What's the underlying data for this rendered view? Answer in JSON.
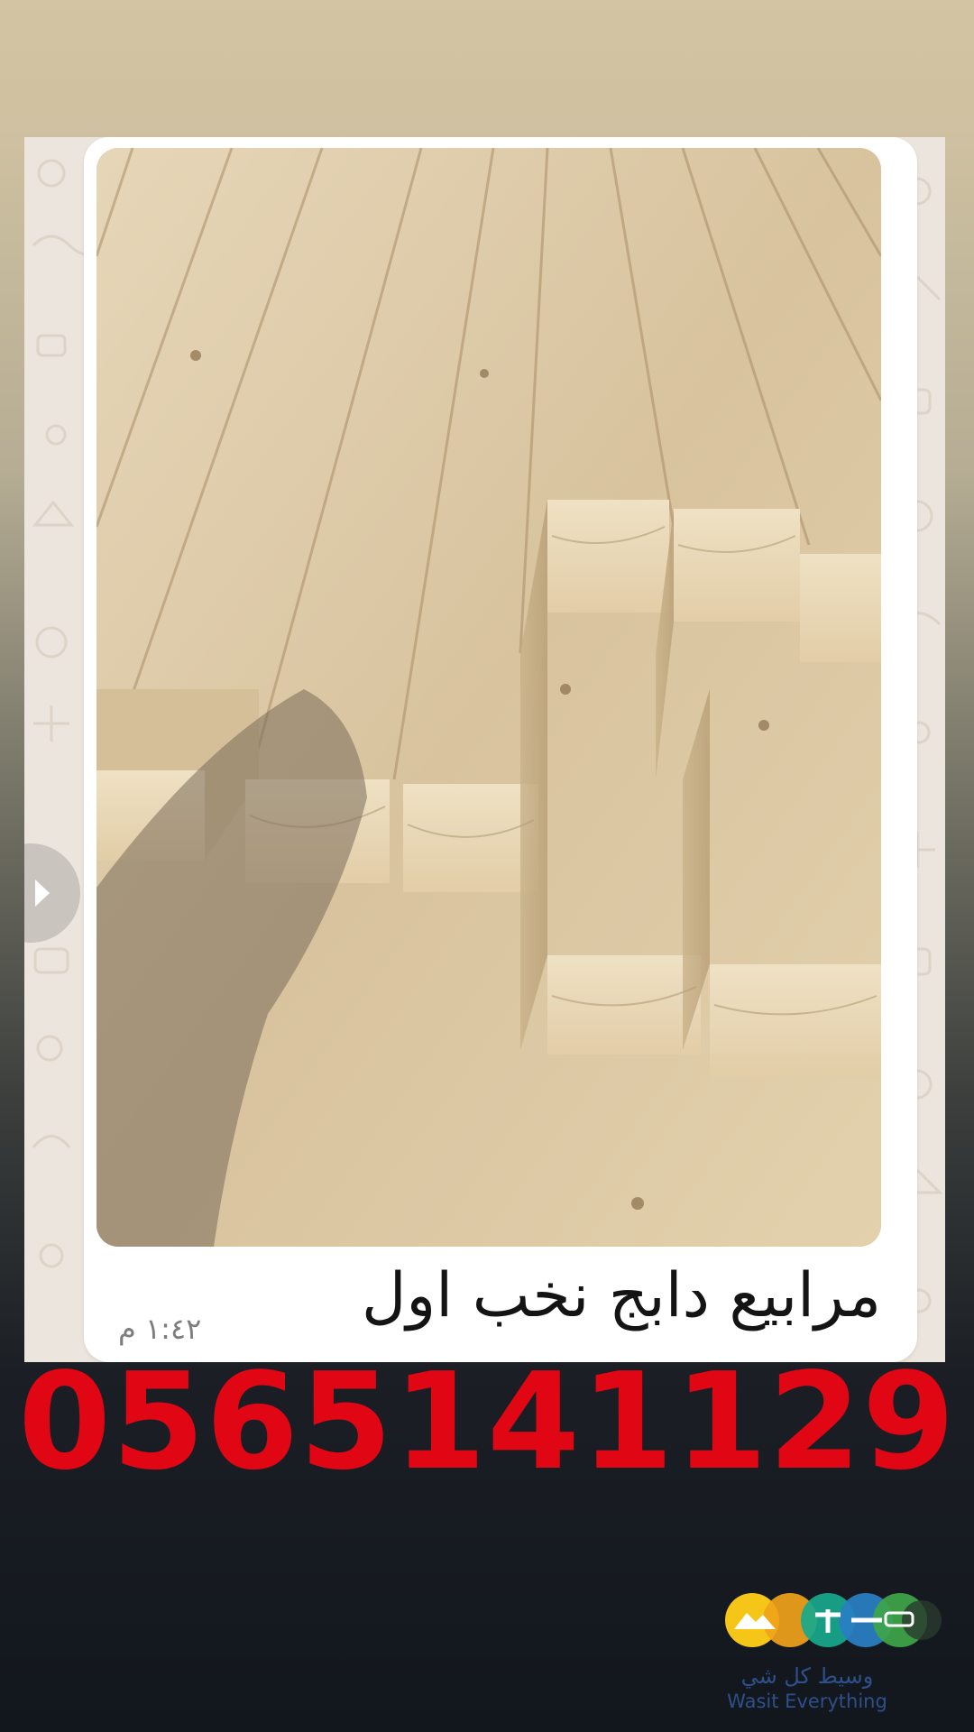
{
  "message": {
    "caption": "مرابيع دابج نخب اول",
    "time": "١:٤٢ م",
    "photo_description": "stack of square pine timber beams"
  },
  "contact": {
    "phone": "0565141129"
  },
  "brand": {
    "name_ar": "وسيط كل شي",
    "name_en": "Wasit Everything"
  },
  "colors": {
    "phone_red": "#e10613",
    "chat_background": "#ece5dd",
    "bubble": "#ffffff",
    "brand_text": "#2f4f8a"
  },
  "icons": {
    "nav": "chevron-right-icon"
  }
}
